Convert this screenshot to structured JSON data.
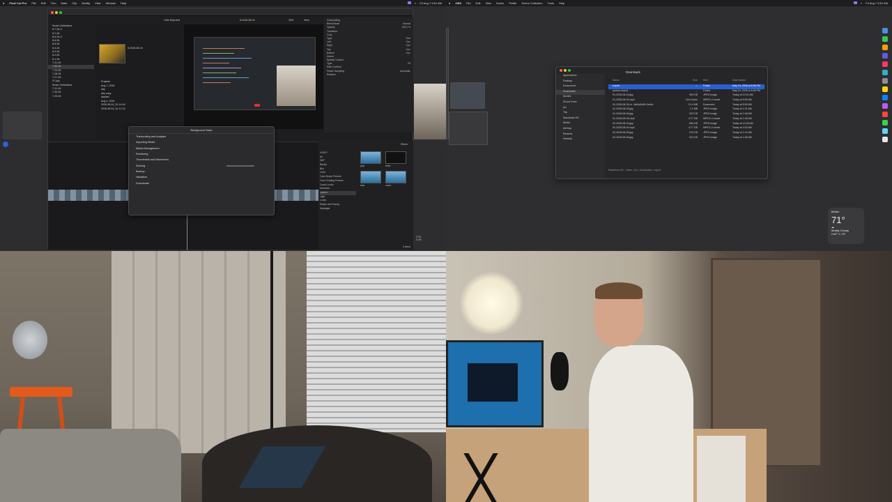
{
  "left_menubar": {
    "app": "Final Cut Pro",
    "items": [
      "File",
      "Edit",
      "Trim",
      "Mark",
      "Clip",
      "Modify",
      "View",
      "Window",
      "Help"
    ],
    "clock": "Fri Aug 7 5:51 AM"
  },
  "right_menubar": {
    "app": "OBS",
    "items": [
      "File",
      "Edit",
      "View",
      "Docks",
      "Profile",
      "Scene Collection",
      "Tools",
      "Help"
    ],
    "clock": "Fri Aug 7 5:51 AM"
  },
  "fcp": {
    "sidebar": [
      "Smart Collections",
      "8-7-26-II",
      "8-7-26",
      "8-6-26-II",
      "8-6-26",
      "8-5-26",
      "8-4-26",
      "8-3-26",
      "8-2-26",
      "8-1-26",
      "7-31-26",
      "7-30-26",
      "7-29-26",
      "7-28-26",
      "7-27-26",
      "07-july",
      "Smart Collections",
      "7-31-26",
      "7-30-26",
      "7-29-26"
    ],
    "browser_header": "Hide Rejected",
    "clip_name": "8-2026-08-04",
    "browser_items": [
      "Projects",
      "Aug 7, 2026",
      "day",
      "day copy",
      "dayfast",
      "Aug 4, 2026",
      "2026-08-04_20-14-04",
      "2026-08-04_20-12-15"
    ],
    "viewer_title": "8-2026-08-04",
    "viewer_zoom": "30%",
    "viewer_label": "View",
    "inspector": {
      "title": "Normal",
      "rows": [
        {
          "label": "Compositing",
          "value": ""
        },
        {
          "label": "Blend Mode",
          "value": "Normal"
        },
        {
          "label": "Opacity",
          "value": "100.0 %"
        },
        {
          "label": "Transform",
          "value": ""
        },
        {
          "label": "Crop",
          "value": ""
        },
        {
          "label": "Type",
          "value": "Trim"
        },
        {
          "label": "Left",
          "value": "0 px"
        },
        {
          "label": "Right",
          "value": "0 px"
        },
        {
          "label": "Top",
          "value": "0 px"
        },
        {
          "label": "Bottom",
          "value": "0 px"
        },
        {
          "label": "Distort",
          "value": ""
        },
        {
          "label": "Spatial Conform",
          "value": ""
        },
        {
          "label": "Type",
          "value": "Fit"
        },
        {
          "label": "Rate Conform",
          "value": ""
        },
        {
          "label": "Frame Sampling",
          "value": "Automatic"
        },
        {
          "label": "Rotation",
          "value": ""
        }
      ]
    },
    "background_tasks": {
      "title": "Background Tasks",
      "tasks": [
        "Transcoding and Analysis",
        "Importing Media",
        "Media Management",
        "Rendering",
        "Thumbnails and Waveforms",
        "Sharing",
        "Backup",
        "Validation",
        "Downloads"
      ]
    },
    "effects": {
      "title": "Effects",
      "categories": [
        "VIDEO",
        "All",
        "360°",
        "Basics",
        "Blur",
        "Color",
        "Color Board Presets",
        "Color Grading Presets",
        "Comic Looks",
        "Distortion",
        "custom",
        "Light",
        "Looks",
        "Masks and Keying",
        "Nostalgia"
      ],
      "thumbs": [
        "pipe",
        "ebbs",
        "blue",
        "zoom"
      ],
      "count": "6 items"
    },
    "cpu": "CPU: 6.3%"
  },
  "finder": {
    "title": "Downloads",
    "sidebar": [
      "Applications",
      "Desktop",
      "Documents",
      "Downloads",
      "Movies",
      "iCloud Drive",
      "jlm",
      "Trip",
      "Macintosh HD",
      "Media",
      "AirDrop",
      "Recents",
      "Network"
    ],
    "columns": [
      "Name",
      "Size",
      "Kind",
      "Date Added"
    ],
    "rows": [
      {
        "name": "export",
        "size": "--",
        "kind": "Folder",
        "date": "May 24, 2026 at 6:06 PM"
      },
      {
        "name": "photos-import",
        "size": "--",
        "kind": "Folder",
        "date": "May 24, 2026 at 6:06 PM"
      },
      {
        "name": "01-2026-08-04.jpg",
        "size": "963 KB",
        "kind": "JPEG image",
        "date": "Today at 10:31 AM"
      },
      {
        "name": "01-2026-08-04.mp4",
        "size": "Zero bytes",
        "kind": "MPEG-4 movie",
        "date": "Today at 5:50 AM"
      },
      {
        "name": "01-2026-08-04.m...6cf4a3e9b-2ad4b",
        "size": "21.4 MB",
        "kind": "Document",
        "date": "Today at 5:50 AM"
      },
      {
        "name": "01-2026-08-05.jpg",
        "size": "1.1 MB",
        "kind": "JPEG image",
        "date": "Today at 1:21 AM"
      },
      {
        "name": "01-2026-08-06.jpg",
        "size": "922 KB",
        "kind": "JPEG image",
        "date": "Today at 1:46 AM"
      },
      {
        "name": "01-2026-08-06.mp4",
        "size": "4.77 GB",
        "kind": "MPEG-4 movie",
        "date": "Today at 1:45 AM"
      },
      {
        "name": "02-2026-08-04.jpg",
        "size": "684 KB",
        "kind": "JPEG image",
        "date": "Today at 10:28 AM"
      },
      {
        "name": "02-2026-08-04.mp4",
        "size": "4.77 GB",
        "kind": "MPEG-4 movie",
        "date": "Today at 4:02 AM"
      },
      {
        "name": "02-2026-08-05.jpg",
        "size": "875 KB",
        "kind": "JPEG image",
        "date": "Today at 1:22 AM"
      },
      {
        "name": "02-2026-08-06.jpg",
        "size": "812 KB",
        "kind": "JPEG image",
        "date": "Today at 1:46 AM"
      }
    ],
    "path": "Macintosh HD › Users › jlm › Downloads › export"
  },
  "weather": {
    "city": "Belton",
    "temp": "71°",
    "condition": "Mostly Cloudy",
    "range": "H:87° L:70°"
  },
  "colors": {
    "accent": "#2a5fd0",
    "fcp_bg": "#1e1e20",
    "obs_purple": "#8c7bff"
  }
}
